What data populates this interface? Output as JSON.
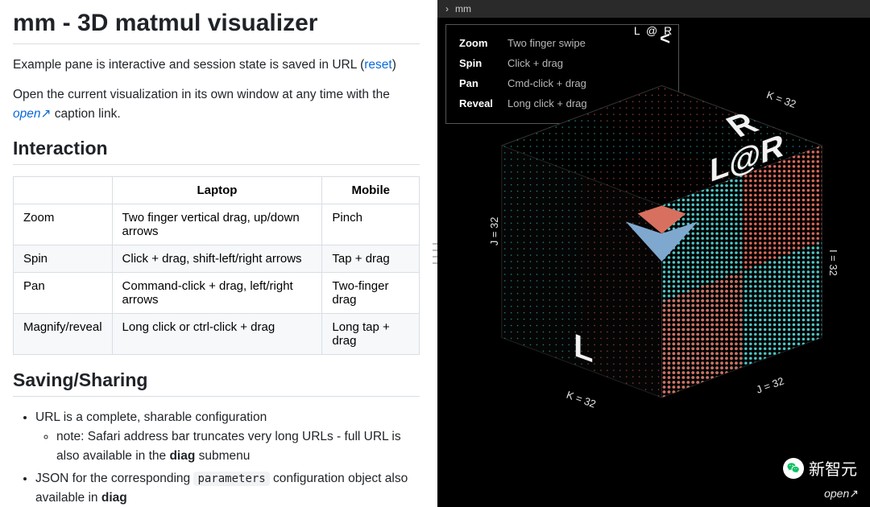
{
  "title": "mm - 3D matmul visualizer",
  "intro": {
    "line1_a": "Example pane is interactive and session state is saved in URL (",
    "reset": "reset",
    "line1_b": ")",
    "line2_a": "Open the current visualization in its own window at any time with the ",
    "open_label": "open",
    "open_arrow": "↗",
    "line2_b": " caption link."
  },
  "sections": {
    "interaction": "Interaction",
    "saving": "Saving/Sharing"
  },
  "table": {
    "head_laptop": "Laptop",
    "head_mobile": "Mobile",
    "rows": [
      {
        "name": "Zoom",
        "laptop": "Two finger vertical drag, up/down arrows",
        "mobile": "Pinch"
      },
      {
        "name": "Spin",
        "laptop": "Click + drag, shift-left/right arrows",
        "mobile": "Tap + drag"
      },
      {
        "name": "Pan",
        "laptop": "Command-click + drag, left/right arrows",
        "mobile": "Two-finger drag"
      },
      {
        "name": "Magnify/reveal",
        "laptop": "Long click or ctrl-click + drag",
        "mobile": "Long tap + drag"
      }
    ]
  },
  "saving": {
    "b1": "URL is a complete, sharable configuration",
    "b1_sub_a": "note: Safari address bar truncates very long URLs - full URL is also available in the ",
    "b1_sub_b": "diag",
    "b1_sub_c": " submenu",
    "b2_a": "JSON for the corresponding ",
    "b2_code": "parameters",
    "b2_b": " configuration object also available in ",
    "b2_c": "diag"
  },
  "right": {
    "breadcrumb_chevron": "›",
    "breadcrumb_item": "mm",
    "caption": "L @ R",
    "hud_close": "<",
    "hud": [
      {
        "k": "Zoom",
        "v": "Two finger swipe"
      },
      {
        "k": "Spin",
        "v": "Click + drag"
      },
      {
        "k": "Pan",
        "v": "Cmd-click + drag"
      },
      {
        "k": "Reveal",
        "v": "Long click + drag"
      }
    ],
    "labels": {
      "k32_a": "K = 32",
      "k32_b": "K = 32",
      "j32_a": "J = 32",
      "j32_b": "J = 32",
      "i32": "I = 32",
      "L": "L",
      "R": "R",
      "LR": "L@R"
    },
    "open_label": "open",
    "open_arrow": "↗",
    "watermark": "新智元"
  }
}
